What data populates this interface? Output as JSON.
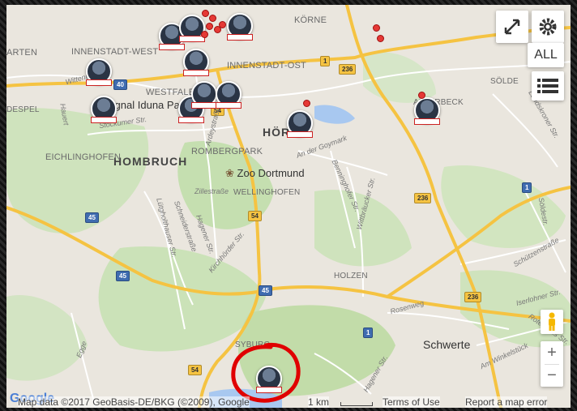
{
  "map": {
    "districts": [
      "ARTEN",
      "INNENSTADT-WEST",
      "INNENSTADT-OST",
      "KÖRNE",
      "WESTFALEN",
      "Signal Iduna Park",
      "HÖRDE",
      "HOMBRUCH",
      "EICHLINGHOFEN",
      "ROMBERGPARK",
      "Zoo Dortmund",
      "WELLINGHOFEN",
      "HOLZEN",
      "SÖLDE",
      "APLERBECK",
      "DESPEL",
      "SYBURG"
    ],
    "city": "Schwerte",
    "streets": [
      "Wittener Str.",
      "Hauert",
      "Stockumer Str.",
      "Ardeystraße",
      "Zillestraße",
      "Lütgholthauser Str.",
      "Schneiderstraße",
      "Hagener Str.",
      "Kirchhörder Str.",
      "An der Goymark",
      "Benninghofer Str.",
      "Wittbräucker Str.",
      "Landskroner Str.",
      "Schützenstraße",
      "Rosenweg",
      "Iserlohner Str.",
      "Am Winkelstück",
      "Egge",
      "Söldestr.",
      "Hagener Str.",
      "Rote Haus Str."
    ],
    "roads": [
      "1",
      "236",
      "40",
      "54",
      "45",
      "236",
      "1",
      "54",
      "45",
      "45",
      "45",
      "236",
      "1",
      "54"
    ]
  },
  "controls": {
    "fullscreen_icon": "expand-arrows-icon",
    "settings_icon": "gear-icon",
    "all_label": "ALL",
    "list_icon": "list-icon",
    "zoom_in": "+",
    "zoom_out": "−",
    "pegman_icon": "pegman-icon"
  },
  "attribution": {
    "google": "Google",
    "data": "Map data ©2017 GeoBasis-DE/BKG (©2009), Google",
    "scale": "1 km",
    "terms": "Terms of Use",
    "report": "Report a map error"
  },
  "annotation": {
    "type": "red-circle",
    "color": "#e00000"
  },
  "colors": {
    "land": "#eae6de",
    "green": "#c8dfb8",
    "highway": "#f5c342",
    "water": "#a8c8f0",
    "marker": "#e53935"
  }
}
